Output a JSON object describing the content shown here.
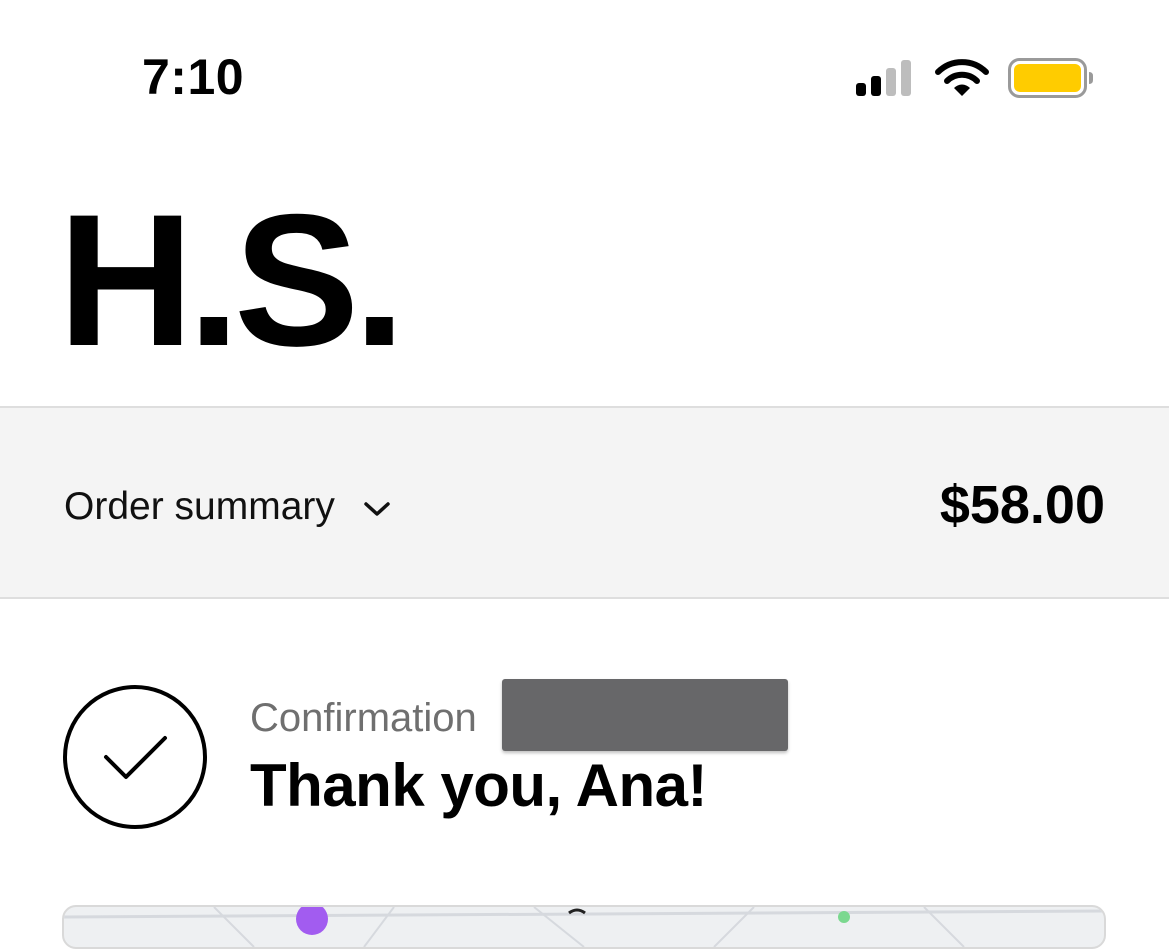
{
  "status_bar": {
    "time": "7:10",
    "icons": [
      "signal-icon",
      "wifi-icon",
      "battery-icon"
    ],
    "battery_color": "#FFCC00"
  },
  "header": {
    "logo_text": "H.S."
  },
  "order_summary": {
    "label": "Order summary",
    "toggle_icon": "chevron-down-icon",
    "total": "$58.00"
  },
  "confirmation": {
    "label": "Confirmation",
    "title": "Thank you, Ana!",
    "icon": "check-circle-icon"
  },
  "map": {
    "icon": "map-preview"
  }
}
